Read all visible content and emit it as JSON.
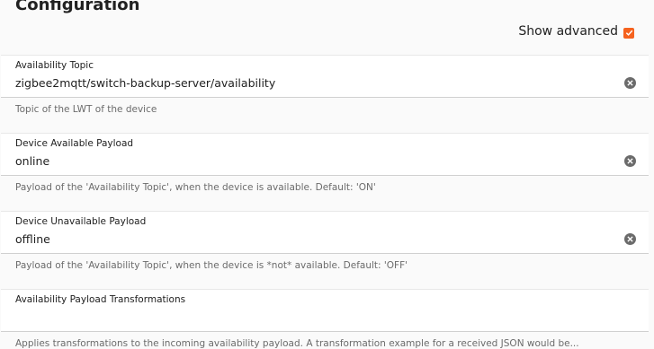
{
  "page": {
    "title": "Configuration",
    "show_advanced_label": "Show advanced",
    "show_advanced_checked": true
  },
  "colors": {
    "accent": "#f5621e",
    "field_bg": "#ffffff",
    "page_bg": "#fafafa",
    "helper_text": "#6b6b6b"
  },
  "fields": [
    {
      "label": "Availability Topic",
      "value": "zigbee2mqtt/switch-backup-server/availability",
      "helper": "Topic of the LWT of the device"
    },
    {
      "label": "Device Available Payload",
      "value": "online",
      "helper": "Payload of the 'Availability Topic', when the device is available. Default: 'ON'"
    },
    {
      "label": "Device Unavailable Payload",
      "value": "offline",
      "helper": "Payload of the 'Availability Topic', when the device is *not* available. Default: 'OFF'"
    },
    {
      "label": "Availability Payload Transformations",
      "value": "",
      "helper": "Applies transformations to the incoming availability payload. A transformation example for a received JSON would be..."
    }
  ]
}
